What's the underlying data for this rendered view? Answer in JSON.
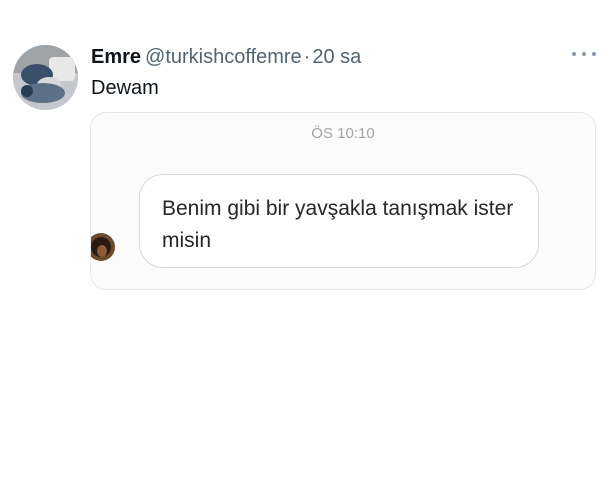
{
  "tweet": {
    "author_name": "Emre",
    "handle": "@turkishcoffemre",
    "separator": "·",
    "time": "20 sa",
    "text": "Dewam"
  },
  "media": {
    "chat_time": "ÖS 10:10",
    "message": "Benim gibi bir yavşakla tanışmak ister misin"
  },
  "icons": {
    "more": "more-horizontal-icon"
  }
}
